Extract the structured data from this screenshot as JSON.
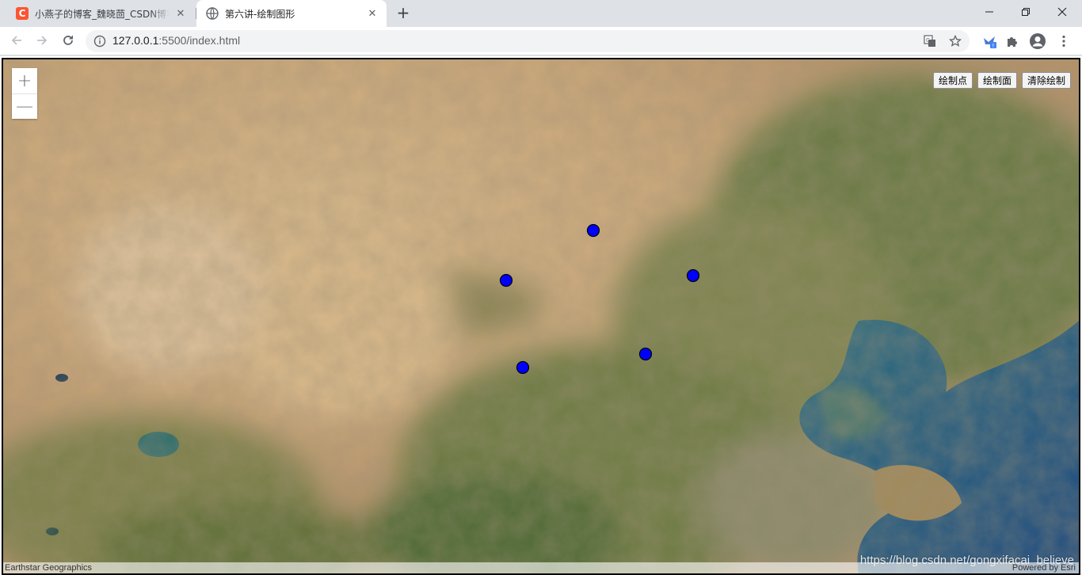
{
  "browser": {
    "tabs": [
      {
        "title": "小燕子的博客_魏晓茴_CSDN博客",
        "favicon": "csdn-logo-icon",
        "favicon_text": "C",
        "active": false
      },
      {
        "title": "第六讲-绘制图形",
        "favicon": "globe-icon",
        "active": true
      }
    ],
    "address": {
      "host": "127.0.0.1",
      "rest": ":5500/index.html"
    }
  },
  "map": {
    "zoom_in_label": "+",
    "zoom_out_label": "—",
    "tools": [
      {
        "label": "绘制点"
      },
      {
        "label": "绘制面"
      },
      {
        "label": "清除绘制"
      }
    ],
    "attribution_left": "Earthstar Geographics",
    "attribution_right": "Powered by Esri",
    "watermark": "https://blog.csdn.net/gongxifacai_believe",
    "point_color": "#0000ff",
    "point_count": 5
  }
}
